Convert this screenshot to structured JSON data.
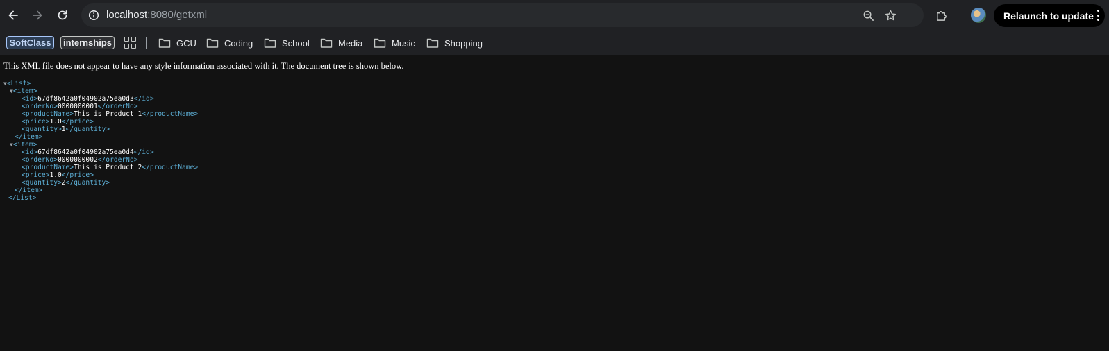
{
  "browser": {
    "url_host": "localhost",
    "url_path": ":8080/getxml",
    "relaunch_label": "Relaunch to update",
    "accent_color": "#a8c7fa"
  },
  "bookmarks": {
    "chips": [
      {
        "label": "SoftClass"
      },
      {
        "label": "internships"
      }
    ],
    "folders": [
      {
        "label": "GCU"
      },
      {
        "label": "Coding"
      },
      {
        "label": "School"
      },
      {
        "label": "Media"
      },
      {
        "label": "Music"
      },
      {
        "label": "Shopping"
      }
    ]
  },
  "xml": {
    "info_text": "This XML file does not appear to have any style information associated with it. The document tree is shown below.",
    "root": "List",
    "element": "item",
    "fields": [
      "id",
      "orderNo",
      "productName",
      "price",
      "quantity"
    ],
    "items": [
      {
        "id": "67df8642a0f04902a75ea0d3",
        "orderNo": "0000000001",
        "productName": "This is Product 1",
        "price": "1.0",
        "quantity": "1"
      },
      {
        "id": "67df8642a0f04902a75ea0d4",
        "orderNo": "0000000002",
        "productName": "This is Product 2",
        "price": "1.0",
        "quantity": "2"
      }
    ],
    "tag_color": "#5db0d7"
  }
}
